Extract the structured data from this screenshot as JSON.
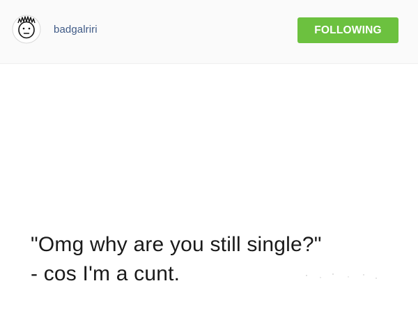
{
  "post": {
    "username": "badgalriri",
    "follow_label": "FOLLOWING",
    "avatar_icon": "cartoon-face-avatar-icon",
    "colors": {
      "username": "#3f5a86",
      "follow_button": "#6cc13f",
      "header_bg": "#fafafa"
    },
    "image_text": {
      "line1": "\"Omg why are you still single?\"",
      "line2": "- cos I'm a cunt."
    }
  }
}
